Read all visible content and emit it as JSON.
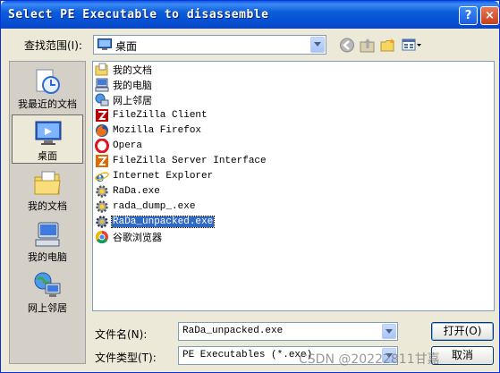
{
  "window": {
    "title": "Select PE Executable to disassemble",
    "help": "?",
    "close": "×"
  },
  "lookin": {
    "label": "查找范围(I):",
    "value": "桌面"
  },
  "places": [
    {
      "label": "我最近的文档",
      "icon": "recent-documents-icon"
    },
    {
      "label": "桌面",
      "icon": "desktop-icon",
      "selected": true
    },
    {
      "label": "我的文档",
      "icon": "my-documents-icon"
    },
    {
      "label": "我的电脑",
      "icon": "my-computer-icon"
    },
    {
      "label": "网上邻居",
      "icon": "network-places-icon"
    }
  ],
  "files": [
    {
      "name": "我的文档",
      "icon": "folder-icon"
    },
    {
      "name": "我的电脑",
      "icon": "computer-icon"
    },
    {
      "name": "网上邻居",
      "icon": "network-icon"
    },
    {
      "name": "FileZilla Client",
      "icon": "filezilla-icon"
    },
    {
      "name": "Mozilla Firefox",
      "icon": "firefox-icon"
    },
    {
      "name": "Opera",
      "icon": "opera-icon"
    },
    {
      "name": "FileZilla Server Interface",
      "icon": "filezilla-server-icon"
    },
    {
      "name": "Internet Explorer",
      "icon": "ie-icon"
    },
    {
      "name": "RaDa.exe",
      "icon": "gear-exe-icon"
    },
    {
      "name": "rada_dump_.exe",
      "icon": "gear-exe-icon"
    },
    {
      "name": "RaDa_unpacked.exe",
      "icon": "gear-exe-icon",
      "selected": true
    },
    {
      "name": "谷歌浏览器",
      "icon": "chrome-icon"
    }
  ],
  "filename": {
    "label": "文件名(N):",
    "value": "RaDa_unpacked.exe"
  },
  "filetype": {
    "label": "文件类型(T):",
    "value": "PE Executables (*.exe)"
  },
  "buttons": {
    "open": "打开(O)",
    "cancel": "取消"
  },
  "watermark": "CSDN @20222811甘嘉"
}
